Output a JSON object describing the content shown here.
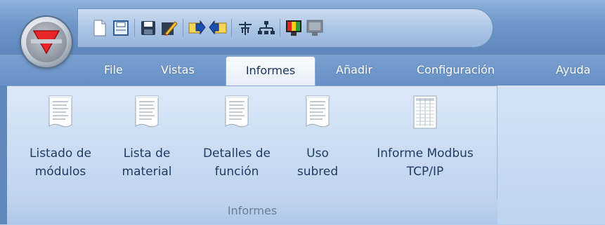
{
  "app": {
    "logo_icon": "red-triangle-logo-icon",
    "accent": "#e8272b"
  },
  "quick_access": [
    {
      "name": "new-document-icon"
    },
    {
      "name": "print-icon"
    },
    {
      "sep": true
    },
    {
      "name": "save-icon"
    },
    {
      "name": "edit-icon"
    },
    {
      "sep": true
    },
    {
      "name": "export-icon"
    },
    {
      "name": "import-icon"
    },
    {
      "sep": true
    },
    {
      "name": "antenna-icon"
    },
    {
      "name": "network-icon"
    },
    {
      "sep": true
    },
    {
      "name": "color-monitor-icon"
    },
    {
      "name": "monitor-icon"
    }
  ],
  "menu": {
    "file": "File",
    "vistas": "Vistas",
    "informes": "Informes",
    "anadir": "Añadir",
    "configuracion": "Configuración",
    "ayuda": "Ayuda"
  },
  "ribbon": {
    "group_label": "Informes",
    "buttons": [
      {
        "line1": "Listado de",
        "line2": "módulos",
        "icon": "report-document-icon"
      },
      {
        "line1": "Lista de",
        "line2": "material",
        "icon": "report-document-icon"
      },
      {
        "line1": "Detalles de",
        "line2": "función",
        "icon": "report-document-icon"
      },
      {
        "line1": "Uso",
        "line2": "subred",
        "icon": "report-document-icon"
      },
      {
        "line1": "Informe Modbus",
        "line2": "TCP/IP",
        "icon": "table-document-icon"
      }
    ]
  }
}
